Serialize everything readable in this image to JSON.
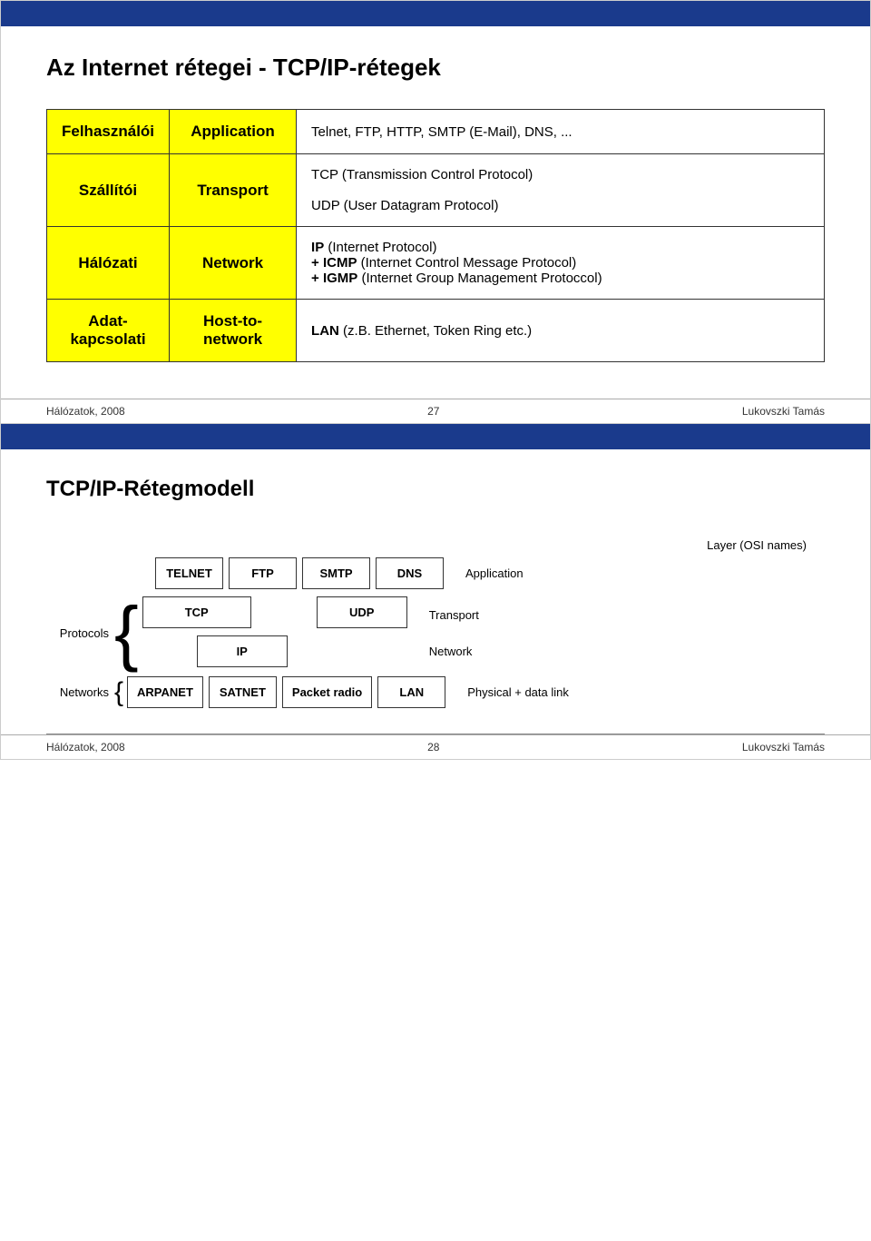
{
  "slide1": {
    "header_bar_color": "#1a3a8c",
    "title": "Az Internet rétegei - TCP/IP-rétegek",
    "table": {
      "rows": [
        {
          "hungarian": "Felhasználói",
          "english": "Application",
          "protocols": "Telnet, FTP, HTTP, SMTP (E-Mail), DNS, ..."
        },
        {
          "hungarian": "Szállítói",
          "english": "Transport",
          "protocols_line1": "TCP (Transmission Control Protocol)",
          "protocols_line2": "UDP (User Datagram Protocol)"
        },
        {
          "hungarian": "Hálózati",
          "english": "Network",
          "protocols_ip": "IP",
          "protocols_ip_full": "(Internet Protocol)",
          "protocols_icmp": "+ ICMP",
          "protocols_icmp_full": "(Internet Control Message Protocol)",
          "protocols_igmp": "+ IGMP",
          "protocols_igmp_full": "(Internet  Group Management Protoccol)"
        },
        {
          "hungarian": "Adat-kapcsolati",
          "english": "Host-to-network",
          "protocols": "LAN (z.B. Ethernet, Token Ring etc.)"
        }
      ]
    },
    "footer": {
      "left": "Hálózatok, 2008",
      "center": "27",
      "right": "Lukovszki Tamás"
    }
  },
  "slide2": {
    "header_bar_color": "#1a3a8c",
    "title": "TCP/IP-Rétegmodell",
    "diagram": {
      "osi_label": "Layer (OSI names)",
      "rows": [
        {
          "left_label": "",
          "boxes": [
            "TELNET",
            "FTP",
            "SMTP",
            "DNS"
          ],
          "right_label": "Application"
        },
        {
          "left_label": "Protocols",
          "boxes": [
            "TCP",
            "UDP"
          ],
          "right_label": "Transport"
        },
        {
          "left_label": "",
          "boxes": [
            "IP"
          ],
          "right_label": "Network"
        },
        {
          "left_label": "Networks",
          "boxes": [
            "ARPANET",
            "SATNET",
            "Packet radio",
            "LAN"
          ],
          "right_label": "Physical + data link"
        }
      ]
    },
    "footer": {
      "left": "Hálózatok, 2008",
      "center": "28",
      "right": "Lukovszki Tamás"
    }
  }
}
